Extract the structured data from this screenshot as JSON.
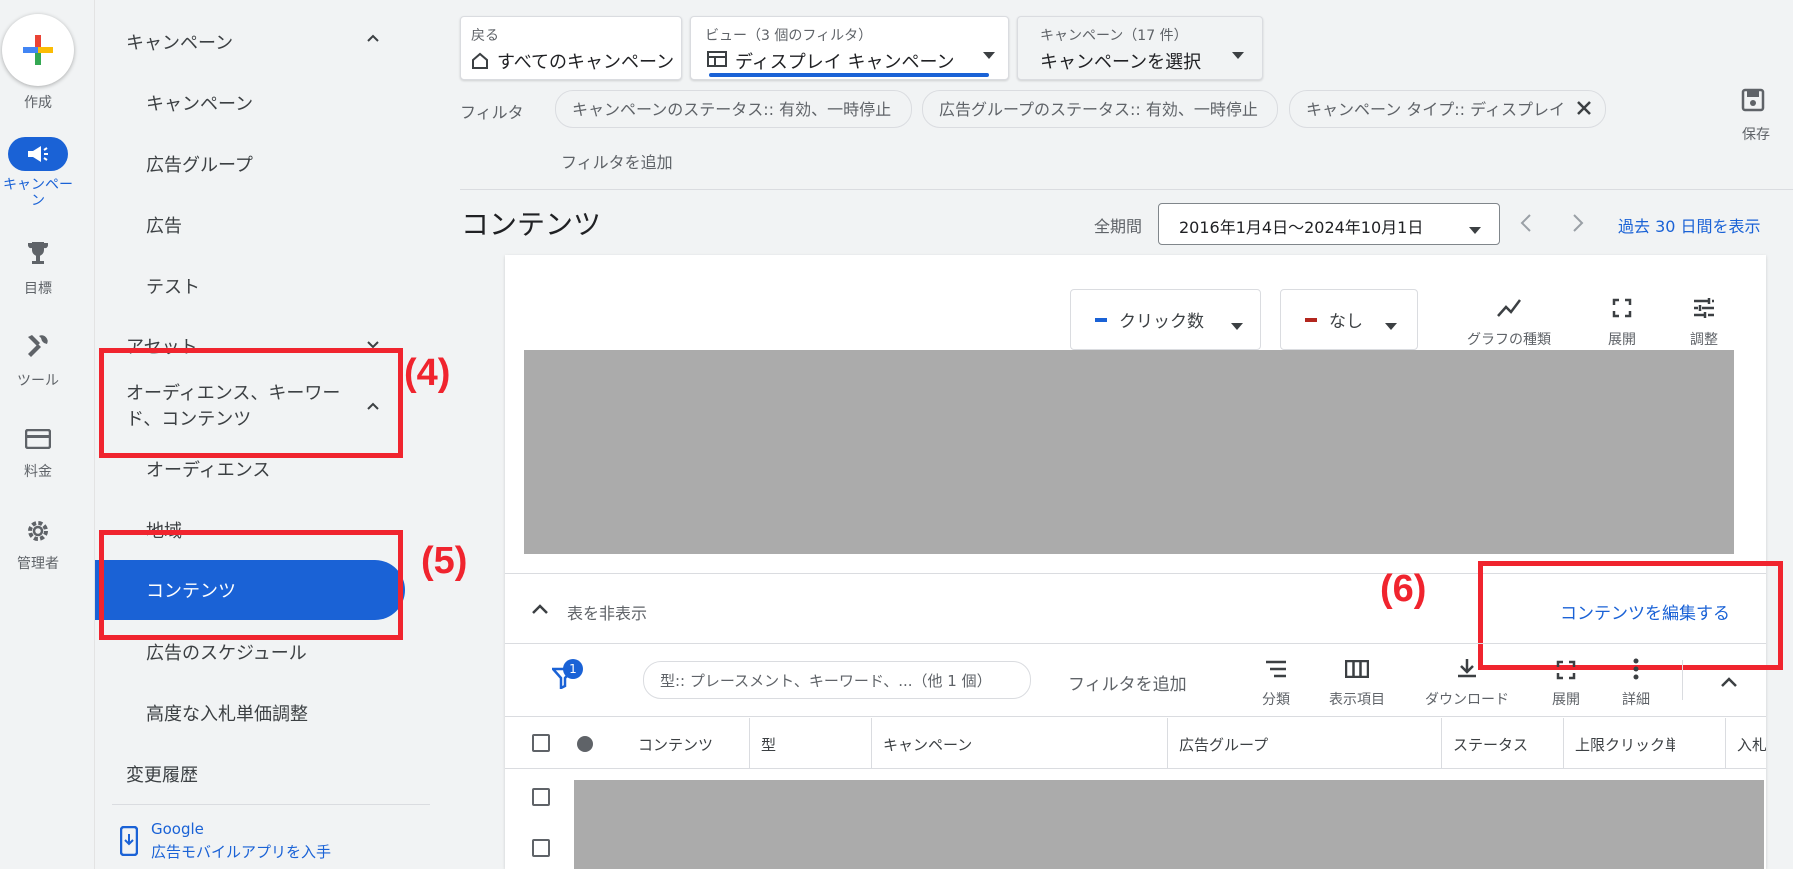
{
  "rail": {
    "create": "作成",
    "campaigns": "キャンペー\nン",
    "goals": "目標",
    "tools": "ツール",
    "billing": "料金",
    "admin": "管理者"
  },
  "nav": {
    "campaigns_header": "キャンペーン",
    "items": [
      "キャンペーン",
      "広告グループ",
      "広告",
      "テスト"
    ],
    "assets": "アセット",
    "audiences_header": "オーディエンス、キーワー\nド、コンテンツ",
    "sub_items": [
      "オーディエンス",
      "地域",
      "コンテンツ",
      "広告のスケジュール",
      "高度な入札単価調整"
    ],
    "change_history": "変更履歴",
    "app_promo_line1": "Google",
    "app_promo_line2": "広告モバイルアプリを入手"
  },
  "annotations": {
    "a4": "(4)",
    "a5": "(5)",
    "a6": "(6)"
  },
  "top": {
    "back_small": "戻る",
    "back_big": "すべてのキャンペーン",
    "view_small": "ビュー（3 個のフィルタ）",
    "view_big": "ディスプレイ キャンペーン",
    "camp_small": "キャンペーン（17 件）",
    "camp_big": "キャンペーンを選択",
    "filter_label": "フィルタ",
    "chips": [
      "キャンペーンのステータス:: 有効、一時停止",
      "広告グループのステータス:: 有効、一時停止",
      "キャンペーン タイプ:: ディスプレイ"
    ],
    "add_filter": "フィルタを追加",
    "save": "保存"
  },
  "page": {
    "title": "コンテンツ",
    "period_label": "全期間",
    "date_range": "2016年1月4日〜2024年10月1日",
    "last30": "過去 30 日間を表示"
  },
  "chart_controls": {
    "metric1": "クリック数",
    "metric2": "なし",
    "graph_type": "グラフの種類",
    "expand": "展開",
    "adjust": "調整"
  },
  "table": {
    "hide_table": "表を非表示",
    "edit_content": "コンテンツを編集する",
    "filter_badge": "1",
    "filter_chip": "型:: プレースメント、キーワード、...（他 1 個）",
    "add_filter": "フィルタを追加",
    "tools": [
      "分類",
      "表示項目",
      "ダウンロード",
      "展開",
      "詳細"
    ],
    "headers": [
      "コンテンツ",
      "型",
      "キャンペーン",
      "広告グループ",
      "ステータス",
      "上限クリック単",
      "入札"
    ]
  },
  "colors": {
    "accent": "#1a62d6",
    "annotation": "#f0242e",
    "metric1": "#1a62d6",
    "metric2": "#b3261e"
  }
}
